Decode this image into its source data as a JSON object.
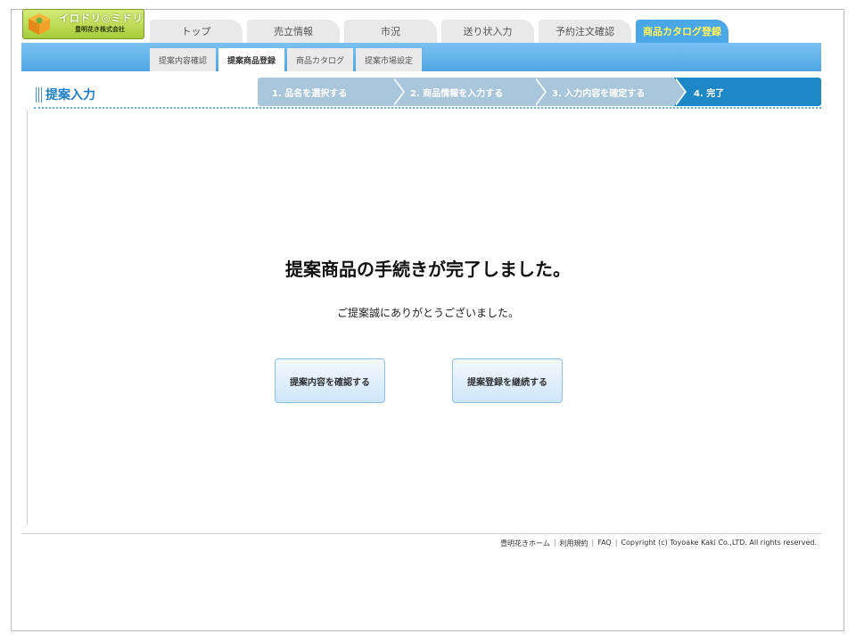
{
  "logo": {
    "title": "イロドリ◎ミドリ",
    "company": "豊明花き株式会社",
    "icon": "logo-box-icon"
  },
  "main_tabs": [
    {
      "label": "トップ"
    },
    {
      "label": "売立情報"
    },
    {
      "label": "市況"
    },
    {
      "label": "送り状入力"
    },
    {
      "label": "予約注文確認"
    },
    {
      "label": "商品カタログ登録",
      "active": true
    }
  ],
  "sub_tabs": [
    {
      "label": "提案内容確認"
    },
    {
      "label": "提案商品登録",
      "active": true
    },
    {
      "label": "商品カタログ"
    },
    {
      "label": "提案市場設定"
    }
  ],
  "section": {
    "title": "提案入力"
  },
  "steps": [
    {
      "label": "1. 品名を選択する"
    },
    {
      "label": "2. 商品情報を入力する"
    },
    {
      "label": "3. 入力内容を確定する"
    },
    {
      "label": "4. 完了",
      "active": true
    }
  ],
  "content": {
    "headline": "提案商品の手続きが完了しました。",
    "message": "ご提案誠にありがとうございました。",
    "confirm_button": "提案内容を確認する",
    "continue_button": "提案登録を継続する"
  },
  "footer": {
    "home": "豊明花きホーム",
    "terms": "利用規約",
    "faq": "FAQ",
    "copyright": "Copyright (c) Toyoake Kaki Co.,LTD. All rights reserved."
  },
  "colors": {
    "accent": "#4aa8e6",
    "active_step": "#1e87c5",
    "inactive_step": "#a9c6da",
    "active_tab_text": "#fff35a",
    "section_title": "#1f7fc3"
  }
}
